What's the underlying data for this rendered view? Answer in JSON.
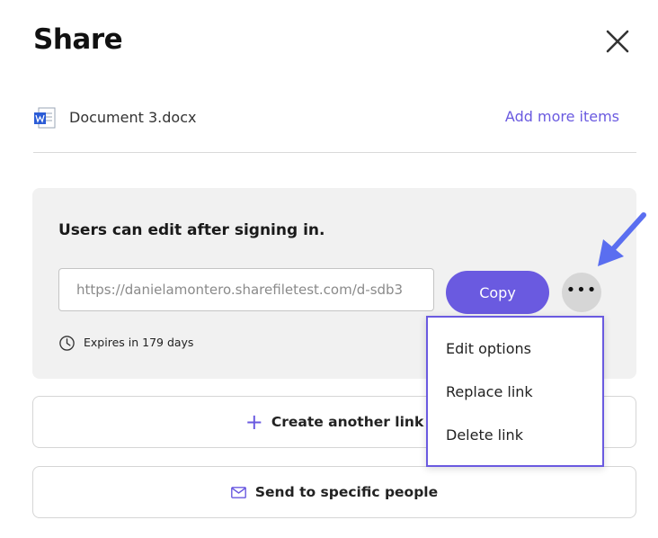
{
  "dialog": {
    "title": "Share"
  },
  "item": {
    "file_name": "Document 3.docx",
    "icon": "word-doc-icon",
    "add_more_label": "Add more items"
  },
  "link": {
    "permission_text": "Users can edit after signing in.",
    "url_value": "https://danielamontero.sharefiletest.com/d-sdb3",
    "copy_label": "Copy",
    "more_label": "•••",
    "expires_text": "Expires in 179 days"
  },
  "menu": {
    "items": [
      {
        "label": "Edit options"
      },
      {
        "label": "Replace link"
      },
      {
        "label": "Delete link"
      }
    ]
  },
  "actions": {
    "create_label": "Create another link",
    "send_label": "Send to specific people"
  },
  "colors": {
    "accent": "#6a5ae0",
    "arrow": "#5a6ef0"
  }
}
